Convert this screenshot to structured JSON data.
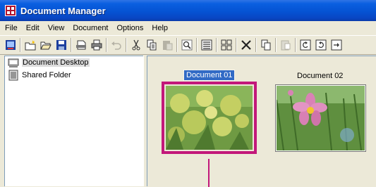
{
  "window": {
    "title": "Document Manager"
  },
  "menu": [
    "File",
    "Edit",
    "View",
    "Document",
    "Options",
    "Help"
  ],
  "toolbar": {
    "icons": [
      "desktop-icon",
      "new-folder-icon",
      "open-folder-icon",
      "save-icon",
      "scan-icon",
      "print-icon",
      "undo-icon",
      "cut-icon",
      "copy-icon",
      "paste-icon",
      "search-icon",
      "list-view-icon",
      "thumbnail-view-icon",
      "delete-icon",
      "copy-page-icon",
      "paste-page-icon",
      "rotate-left-icon",
      "rotate-right-icon",
      "next-page-icon"
    ]
  },
  "tree": {
    "items": [
      {
        "label": "Document Desktop",
        "icon": "desktop-icon"
      },
      {
        "label": "Shared Folder",
        "icon": "shared-folder-icon"
      }
    ]
  },
  "documents": [
    {
      "label": "Document 01",
      "selected": true,
      "thumbnail": "yellow-wildflowers-photo"
    },
    {
      "label": "Document 02",
      "selected": false,
      "thumbnail": "pink-cosmos-flower-photo"
    }
  ],
  "colors": {
    "titlebar": "#0553d3",
    "selection_frame": "#c2187a",
    "label_highlight": "#316ac5"
  }
}
